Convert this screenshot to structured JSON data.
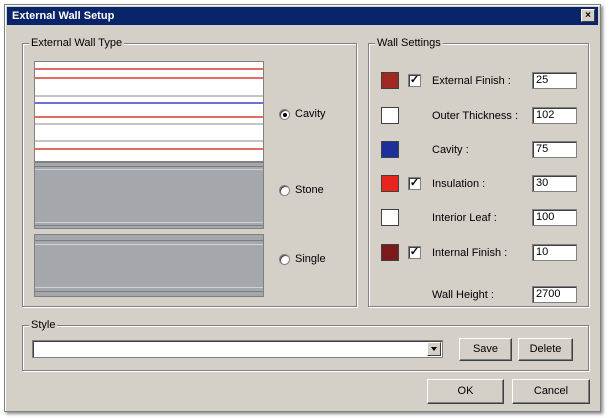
{
  "window": {
    "title": "External Wall Setup",
    "close_glyph": "×"
  },
  "wall_type": {
    "group_label": "External Wall Type",
    "options": [
      {
        "label": "Cavity",
        "selected": true
      },
      {
        "label": "Stone",
        "selected": false
      },
      {
        "label": "Single",
        "selected": false
      }
    ]
  },
  "wall_settings": {
    "group_label": "Wall Settings",
    "rows": [
      {
        "label": "External Finish :",
        "value": "25",
        "color": "#a02820",
        "checkbox": true,
        "checked": true
      },
      {
        "label": "Outer Thickness :",
        "value": "102",
        "color": "#ffffff",
        "checkbox": false,
        "checked": false
      },
      {
        "label": "Cavity :",
        "value": "75",
        "color": "#1c2f9a",
        "checkbox": false,
        "checked": false
      },
      {
        "label": "Insulation :",
        "value": "30",
        "color": "#e8241c",
        "checkbox": true,
        "checked": true
      },
      {
        "label": "Interior Leaf :",
        "value": "100",
        "color": "#ffffff",
        "checkbox": false,
        "checked": false
      },
      {
        "label": "Internal Finish :",
        "value": "10",
        "color": "#7a1a1a",
        "checkbox": true,
        "checked": true
      }
    ],
    "wall_height": {
      "label": "Wall Height :",
      "value": "2700"
    }
  },
  "style": {
    "group_label": "Style",
    "selected_value": "",
    "save_label": "Save",
    "delete_label": "Delete"
  },
  "footer": {
    "ok_label": "OK",
    "cancel_label": "Cancel"
  },
  "colors": {
    "title_bar": "#0a246a",
    "dialog_face": "#d4d0c8",
    "wall_fill": "#a4a8ac",
    "red_line": "#d83a30",
    "blue_line": "#3a44c8"
  }
}
